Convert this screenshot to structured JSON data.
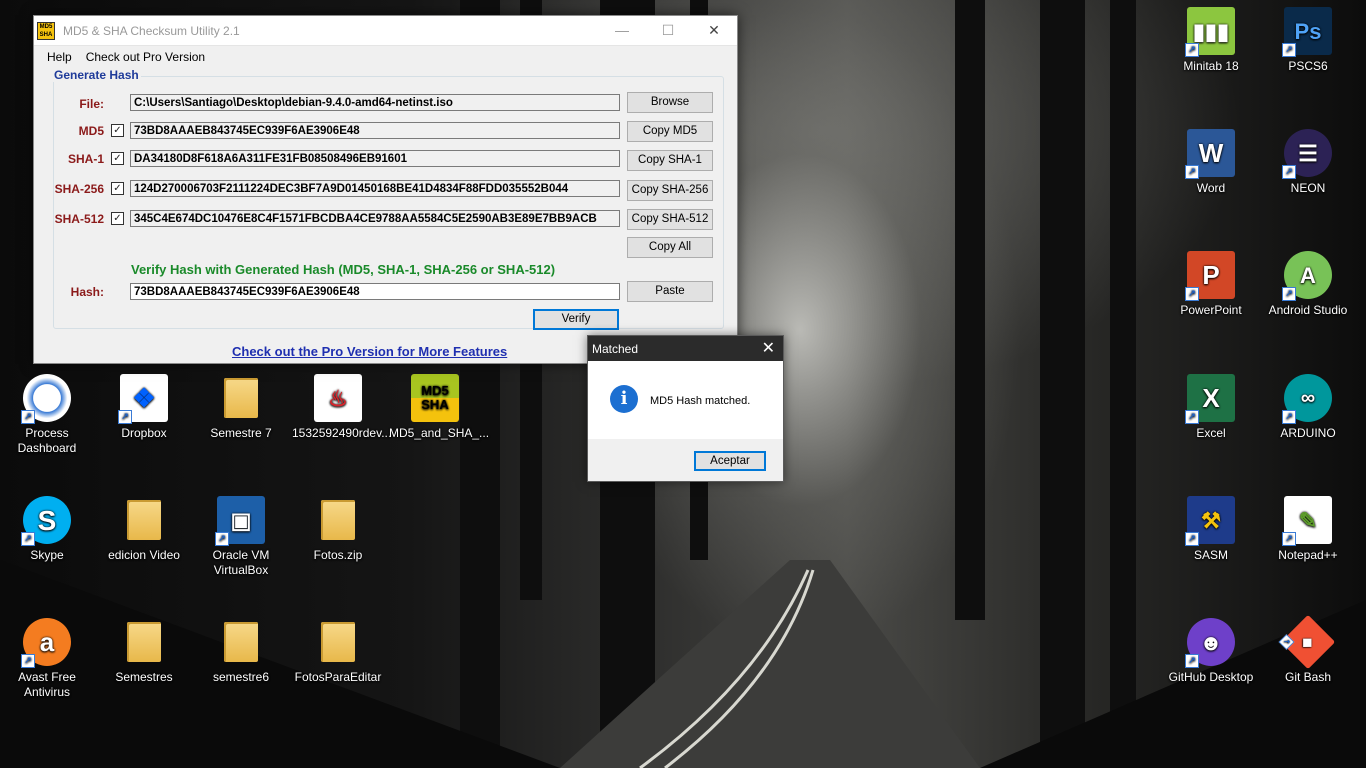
{
  "app": {
    "title": "MD5 & SHA Checksum Utility 2.1",
    "logo_text": "MD5 SHA",
    "window_controls": {
      "minimize": "—",
      "maximize": "☐",
      "close": "✕"
    },
    "menu": [
      "Help",
      "Check out Pro Version"
    ],
    "generate_section_title": "Generate Hash",
    "file": {
      "label": "File:",
      "value": "C:\\Users\\Santiago\\Desktop\\debian-9.4.0-amd64-netinst.iso",
      "button": "Browse"
    },
    "md5": {
      "label": "MD5",
      "checked": true,
      "value": "73BD8AAAEB843745EC939F6AE3906E48",
      "button": "Copy MD5"
    },
    "sha1": {
      "label": "SHA-1",
      "checked": true,
      "value": "DA34180D8F618A6A311FE31FB08508496EB91601",
      "button": "Copy SHA-1"
    },
    "sha256": {
      "label": "SHA-256",
      "checked": true,
      "value": "124D270006703F2111224DEC3BF7A9D01450168BE41D4834F88FDD035552B044",
      "button": "Copy SHA-256"
    },
    "sha512": {
      "label": "SHA-512",
      "checked": true,
      "value": "345C4E674DC10476E8C4F1571FBCDBA4CE9788AA5584C5E2590AB3E89E7BB9ACB",
      "button": "Copy SHA-512"
    },
    "copy_all_button": "Copy All",
    "verify_heading": "Verify Hash with Generated Hash (MD5, SHA-1, SHA-256 or SHA-512)",
    "hash": {
      "label": "Hash:",
      "value": "73BD8AAAEB843745EC939F6AE3906E48",
      "button": "Paste"
    },
    "verify_button": "Verify",
    "pro_link": "Check out the Pro Version for More Features"
  },
  "dialog": {
    "title": "Matched",
    "close": "✕",
    "icon": "info-icon",
    "message": "MD5 Hash matched.",
    "ok_button": "Aceptar"
  },
  "desktop": {
    "left_icons": [
      {
        "label": "Process Dashboard",
        "icon": "process-dashboard-icon"
      },
      {
        "label": "Dropbox",
        "icon": "dropbox-icon"
      },
      {
        "label": "Semestre 7",
        "icon": "folder-icon"
      },
      {
        "label": "1532592490rdev...",
        "icon": "pdf-icon"
      },
      {
        "label": "MD5_and_SHA_...",
        "icon": "md5-sha-icon"
      },
      {
        "label": "Skype",
        "icon": "skype-icon"
      },
      {
        "label": "edicion Video",
        "icon": "folder-icon"
      },
      {
        "label": "Oracle VM VirtualBox",
        "icon": "virtualbox-icon"
      },
      {
        "label": "Fotos.zip",
        "icon": "zip-folder-icon"
      },
      {
        "label": "Avast Free Antivirus",
        "icon": "avast-icon"
      },
      {
        "label": "Semestres",
        "icon": "folder-icon"
      },
      {
        "label": "semestre6",
        "icon": "folder-icon"
      },
      {
        "label": "FotosParaEditar",
        "icon": "folder-icon"
      }
    ],
    "right_icons": [
      {
        "label": "Minitab 18",
        "icon": "minitab-icon"
      },
      {
        "label": "PSCS6",
        "icon": "photoshop-icon"
      },
      {
        "label": "Word",
        "icon": "word-icon"
      },
      {
        "label": "NEON",
        "icon": "eclipse-neon-icon"
      },
      {
        "label": "PowerPoint",
        "icon": "powerpoint-icon"
      },
      {
        "label": "Android Studio",
        "icon": "android-studio-icon"
      },
      {
        "label": "Excel",
        "icon": "excel-icon"
      },
      {
        "label": "ARDUINO",
        "icon": "arduino-icon"
      },
      {
        "label": "SASM",
        "icon": "sasm-icon"
      },
      {
        "label": "Notepad++",
        "icon": "notepadpp-icon"
      },
      {
        "label": "GitHub Desktop",
        "icon": "github-desktop-icon"
      },
      {
        "label": "Git Bash",
        "icon": "git-bash-icon"
      }
    ]
  }
}
